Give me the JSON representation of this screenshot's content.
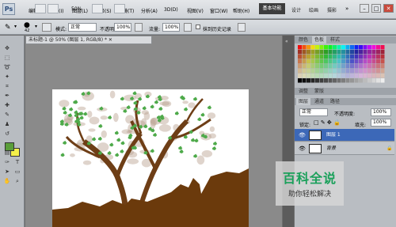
{
  "app": {
    "logo": "Ps"
  },
  "menu": [
    "编辑(E)",
    "图像(I)",
    "图层(L)",
    "选择(S)",
    "滤镜(T)",
    "分析(A)",
    "3D(D)",
    "视图(V)",
    "窗口(W)",
    "帮助(H)"
  ],
  "zoom_readout": "50%",
  "workspace": {
    "active": "基本功能",
    "others": [
      "设计",
      "绘画",
      "摄影"
    ]
  },
  "options": {
    "brush_size": "42",
    "mode_label": "模式:",
    "mode_value": "正常",
    "opacity_label": "不透明度:",
    "opacity_value": "100%",
    "flow_label": "流量:",
    "flow_value": "100%",
    "history_label": "抹到历史记录"
  },
  "document": {
    "tab": "未标题-1 @ 50% (图层 1, RGB/8) *"
  },
  "panels": {
    "top_tabs": [
      "颜色",
      "色板",
      "样式"
    ],
    "mid_tabs": [
      "调整",
      "蒙版"
    ],
    "layer_tabs": [
      "图层",
      "通道",
      "路径"
    ],
    "blend_mode": "正常",
    "opacity_label": "不透明度:",
    "opacity_value": "100%",
    "lock_label": "锁定:",
    "fill_label": "填充:",
    "fill_value": "100%",
    "layers": [
      {
        "name": "图层 1"
      },
      {
        "name": "背景"
      }
    ]
  },
  "colors": {
    "foreground": "#5a9e3a",
    "background": "#f4f04a",
    "dirt": "#6b3a0c",
    "trunk": "#6e3e16",
    "leaf": "#4eaa4a",
    "blossom": "#b9a08d"
  },
  "watermark": {
    "title": "百科全说",
    "subtitle": "助你轻松解决"
  }
}
